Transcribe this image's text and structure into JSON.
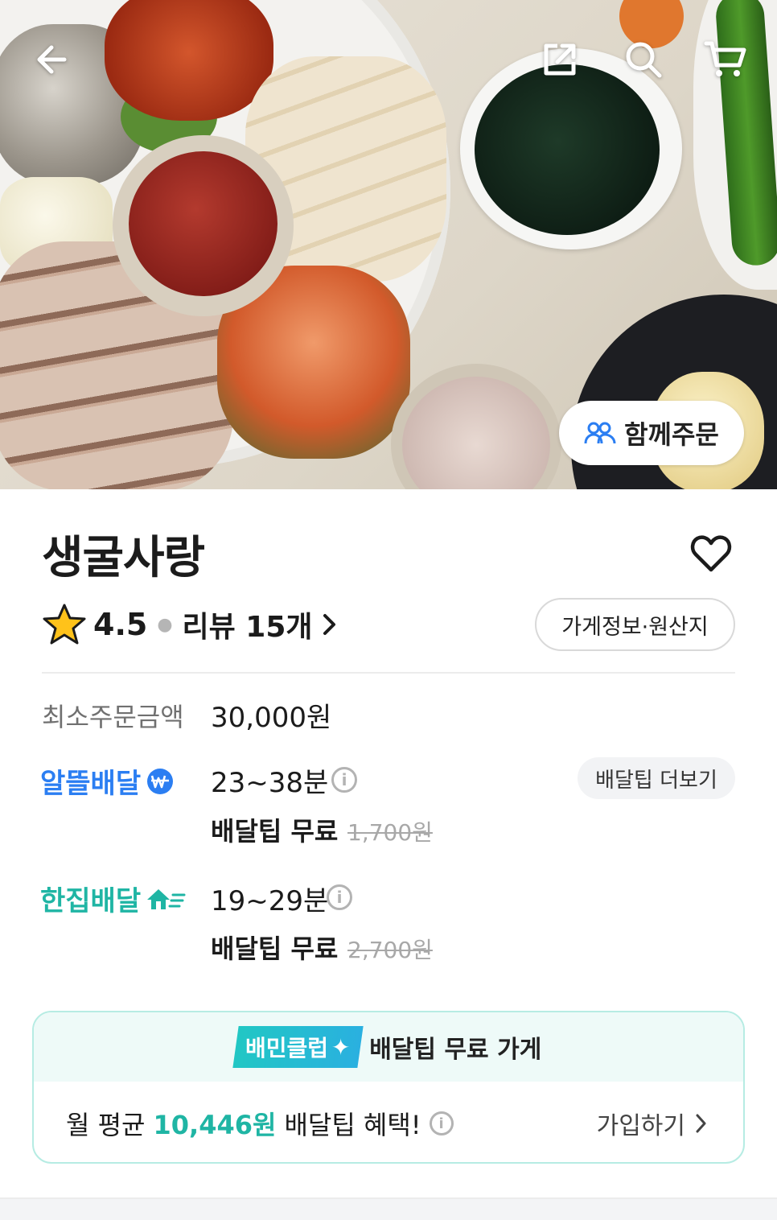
{
  "header": {
    "back_icon": "arrow-left-icon",
    "share_icon": "share-icon",
    "search_icon": "search-icon",
    "cart_icon": "cart-icon"
  },
  "hero": {
    "group_order_label": "함께주문",
    "group_order_icon": "people-icon"
  },
  "store": {
    "name": "생굴사랑",
    "rating": "4.5",
    "review_label": "리뷰 15개",
    "info_button": "가게정보·원산지",
    "favorite_icon": "heart-icon"
  },
  "min_order": {
    "label": "최소주문금액",
    "value": "30,000원"
  },
  "alttle_delivery": {
    "label": "알뜰배달",
    "time": "23~38분",
    "tip_label": "배달팁 무료",
    "original_tip": "1,700원",
    "more_button": "배달팁 더보기"
  },
  "hanjip_delivery": {
    "label": "한집배달",
    "time": "19~29분",
    "tip_label": "배달팁 무료",
    "original_tip": "2,700원"
  },
  "club": {
    "badge": "배민클럽",
    "headline": "배달팁 무료 가게",
    "prefix": "월 평균",
    "amount": "10,446원",
    "suffix": "배달팁 혜택!",
    "join_label": "가입하기"
  },
  "colors": {
    "alttle_blue": "#2b7ef2",
    "hanjip_teal": "#1fb5a4",
    "club_border": "#b6ece3"
  }
}
